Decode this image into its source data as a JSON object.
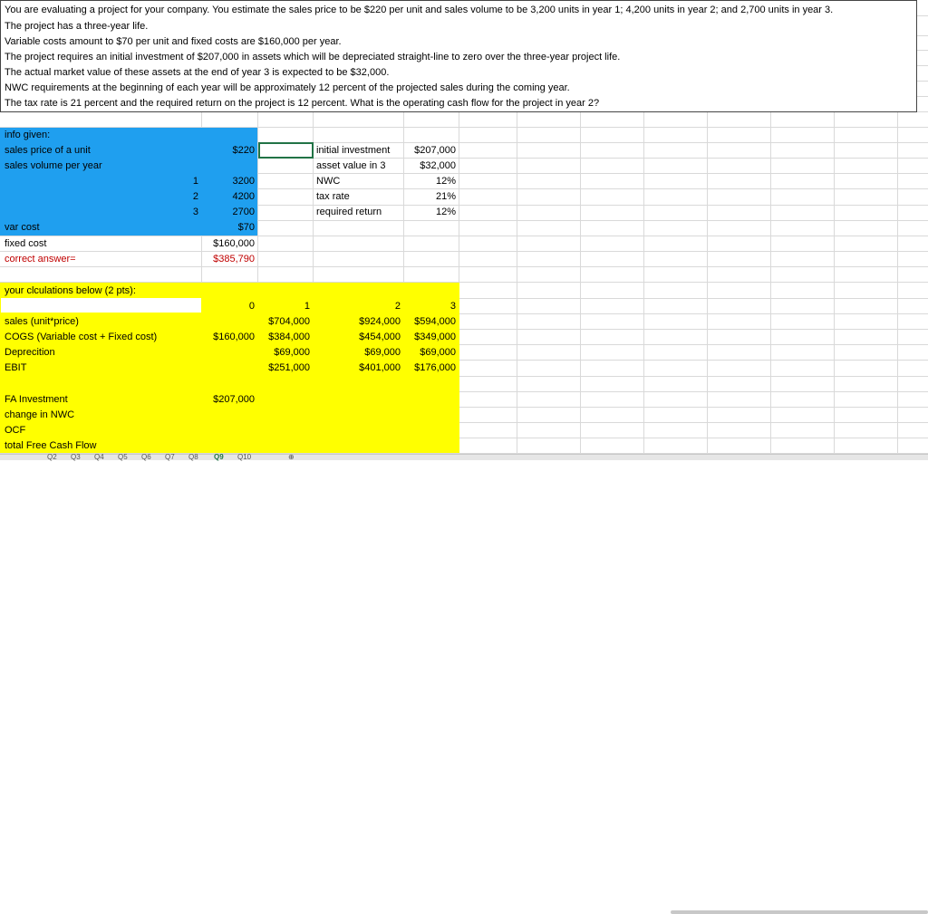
{
  "problem": {
    "lines": [
      "You are evaluating a project for your company. You estimate the sales price to be $220 per unit and sales volume to be 3,200 units in year 1; 4,200 units in year 2; and 2,700 units in year 3.",
      "The project has a three-year life.",
      "Variable costs amount to $70 per unit and fixed costs are $160,000 per year.",
      "The project requires an initial investment of $207,000 in assets which will be depreciated straight-line to zero over the three-year project life.",
      "The actual market value of these assets at the end of year 3 is expected to be $32,000.",
      " NWC requirements at the beginning of each year will be approximately 12 percent of the projected sales during the coming year.",
      "The tax rate is 21 percent and the required return on the project is 12 percent. What is the operating cash flow for the project in year 2?"
    ]
  },
  "given": {
    "header": "info given:",
    "price_label": "sales price of a unit",
    "price_value": "$220",
    "volume_label": "sales volume per year",
    "years": [
      "1",
      "2",
      "3"
    ],
    "volumes": [
      "3200",
      "4200",
      "2700"
    ],
    "var_cost_label": "var cost",
    "var_cost_value": "$70",
    "fixed_cost_label": "fixed cost",
    "fixed_cost_value": "$160,000",
    "correct_label": "correct answer=",
    "correct_value": "$385,790"
  },
  "right_info": {
    "rows": [
      {
        "label": "initial investment",
        "value": "$207,000"
      },
      {
        "label": "asset value in 3",
        "value": "$32,000"
      },
      {
        "label": "NWC",
        "value": "12%"
      },
      {
        "label": "tax rate",
        "value": "21%"
      },
      {
        "label": "required return",
        "value": "12%"
      }
    ]
  },
  "calc": {
    "header": "your clculations below (2 pts):",
    "year_headers": [
      "0",
      "1",
      "2",
      "3"
    ],
    "rows": [
      {
        "label": "sales (unit*price)",
        "y0": "",
        "y1": "$704,000",
        "y2": "$924,000",
        "y3": "$594,000"
      },
      {
        "label": "COGS (Variable cost + Fixed cost)",
        "y0": "$160,000",
        "y1": "$384,000",
        "y2": "$454,000",
        "y3": "$349,000"
      },
      {
        "label": "Deprecition",
        "y0": "",
        "y1": "$69,000",
        "y2": "$69,000",
        "y3": "$69,000"
      },
      {
        "label": "EBIT",
        "y0": "",
        "y1": "$251,000",
        "y2": "$401,000",
        "y3": "$176,000"
      }
    ],
    "fa_label": "FA Investment",
    "fa_y0": "$207,000",
    "nwc_label": "change in NWC",
    "ocf_label": "OCF",
    "tfcf_label": "total Free Cash Flow"
  },
  "tabs": [
    "Q2",
    "Q3",
    "Q4",
    "Q5",
    "Q6",
    "Q7",
    "Q8",
    "Q9",
    "Q10"
  ],
  "colors": {
    "blue": "#1f9fef",
    "yellow": "#ffff00",
    "red": "#c00000"
  }
}
